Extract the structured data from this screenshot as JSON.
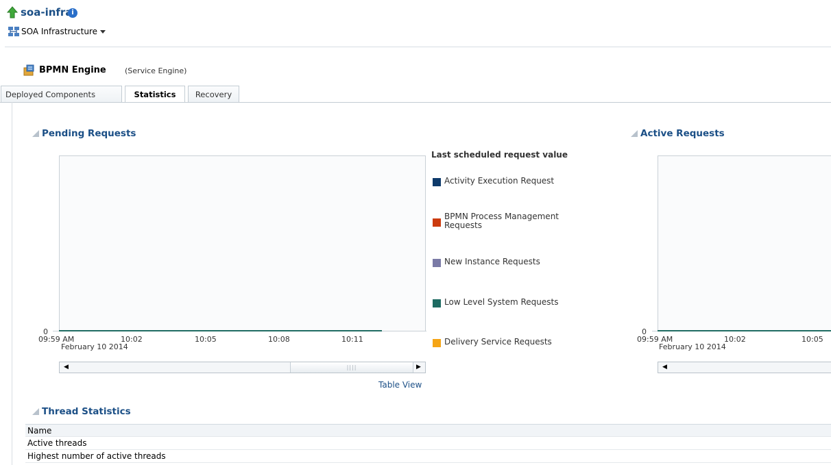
{
  "header": {
    "title": "soa-infra",
    "target_menu_label": "SOA Infrastructure"
  },
  "engine": {
    "title": "BPMN Engine",
    "subtitle": "(Service Engine)"
  },
  "tabs": [
    {
      "label": "Deployed Components",
      "active": false
    },
    {
      "label": "Statistics",
      "active": true
    },
    {
      "label": "Recovery",
      "active": false
    }
  ],
  "pending": {
    "title": "Pending Requests",
    "legend_title": "Last scheduled request value",
    "table_view_label": "Table View"
  },
  "active": {
    "title": "Active Requests"
  },
  "chart_data": [
    {
      "type": "line",
      "title": "Pending Requests",
      "x": [
        "09:59 AM",
        "10:02",
        "10:05",
        "10:08",
        "10:11"
      ],
      "x_date_label": "February 10 2014",
      "y_ticks": [
        "0"
      ],
      "series": [
        {
          "name": "Activity Execution Request",
          "color": "#0e3a6b",
          "values": [
            0,
            0,
            0,
            0,
            0
          ]
        },
        {
          "name": "BPMN Process Management Requests",
          "color": "#cc3b0e",
          "values": [
            0,
            0,
            0,
            0,
            0
          ]
        },
        {
          "name": "New Instance Requests",
          "color": "#7a7aa6",
          "values": [
            0,
            0,
            0,
            0,
            0
          ]
        },
        {
          "name": "Low Level System Requests",
          "color": "#1e6b62",
          "values": [
            0,
            0,
            0,
            0,
            0
          ]
        },
        {
          "name": "Delivery Service Requests",
          "color": "#f5a516",
          "values": [
            0,
            0,
            0,
            0,
            0
          ]
        }
      ]
    },
    {
      "type": "line",
      "title": "Active Requests",
      "x": [
        "09:59 AM",
        "10:02",
        "10:05"
      ],
      "x_date_label": "February 10 2014",
      "y_ticks": [
        "0"
      ],
      "series": [
        {
          "color": "#1e6b62",
          "values": [
            0,
            0,
            0
          ]
        }
      ]
    }
  ],
  "thread_statistics": {
    "title": "Thread Statistics",
    "column_header": "Name",
    "rows": [
      "Active threads",
      "Highest number of active threads"
    ]
  },
  "icons": {
    "up": "up-arrow-icon",
    "info": "info-icon",
    "target": "soa-infrastructure-icon",
    "engine": "bpmn-engine-icon"
  }
}
